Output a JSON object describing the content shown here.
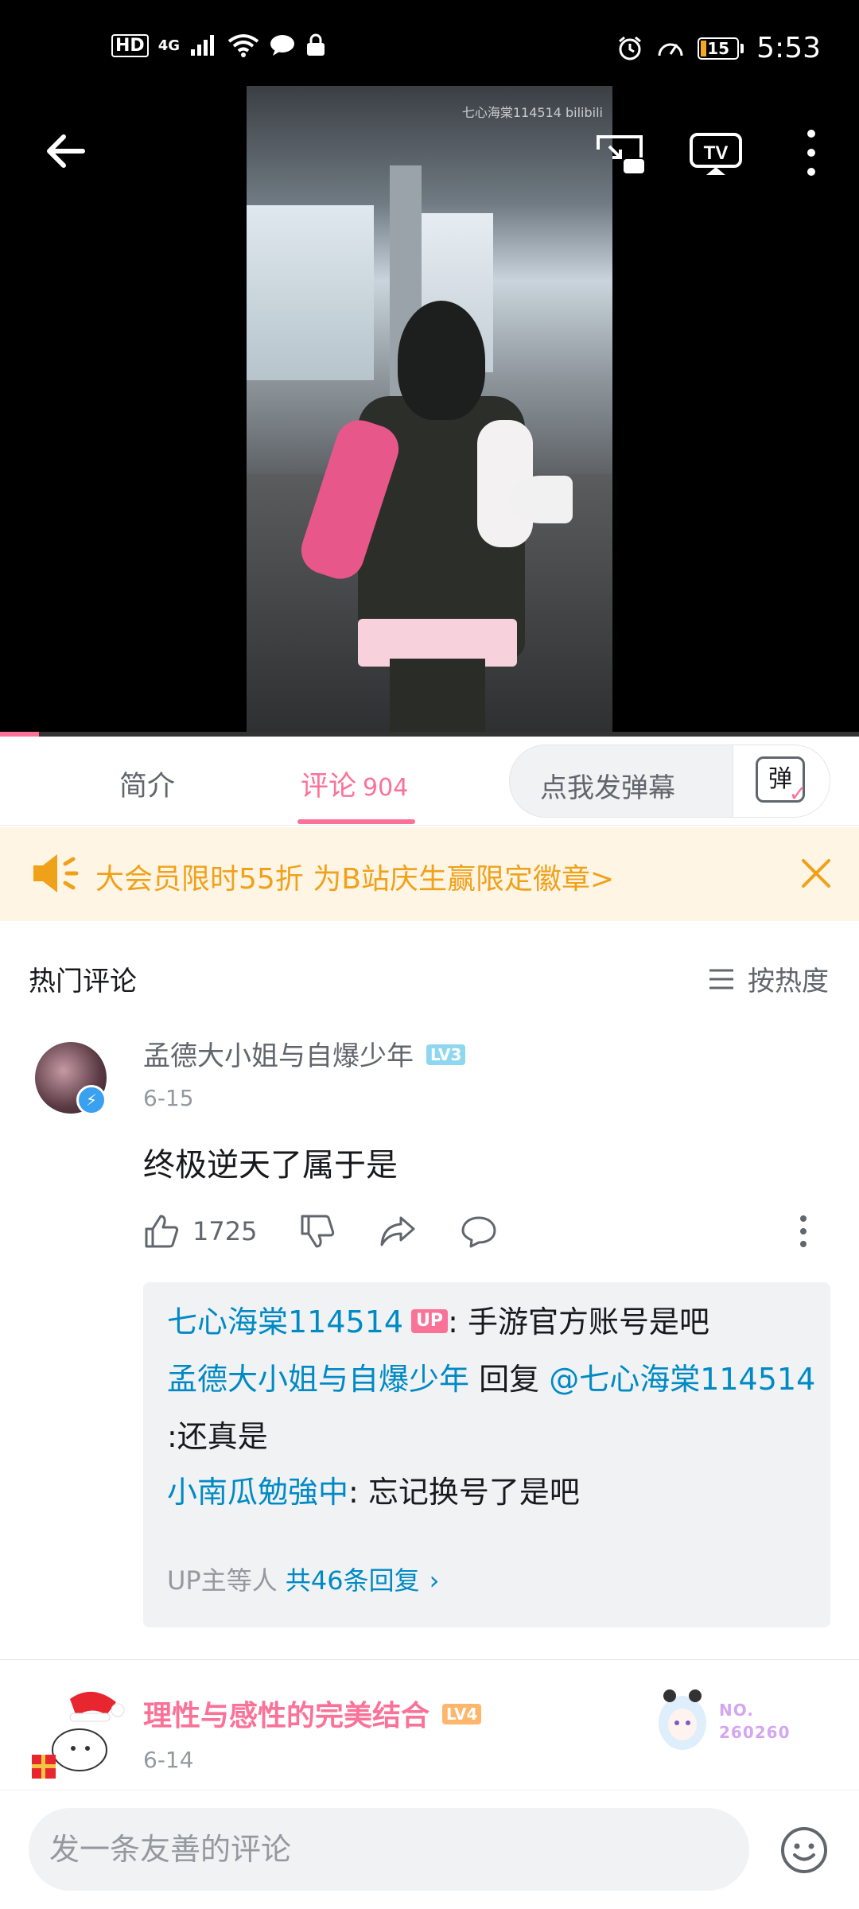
{
  "status_bar": {
    "hd": "HD",
    "network": "4G",
    "battery": "15",
    "battery_level": 0.15,
    "time": "5:53"
  },
  "video": {
    "watermark": "七心海棠114514 bilibili",
    "progress": 0.045
  },
  "tabs": {
    "intro": "简介",
    "comments": "评论",
    "comments_count": "904",
    "danmaku_placeholder": "点我发弹幕",
    "danmaku_icon_label": "弹"
  },
  "promo": {
    "text": "大会员限时55折 为B站庆生赢限定徽章>"
  },
  "comments_section": {
    "title": "热门评论",
    "sort_label": "按热度"
  },
  "comment1": {
    "username": "孟德大小姐与自爆少年",
    "level": "LV3",
    "date": "6-15",
    "text": "终极逆天了属于是",
    "likes": "1725",
    "replies": {
      "r1_name": "七心海棠114514",
      "r1_tag": "UP",
      "r1_text": ": 手游官方账号是吧",
      "r2_name": "孟德大小姐与自爆少年",
      "r2_mid": " 回复 ",
      "r2_mention": "@七心海棠114514",
      "r2_text": " :还真是",
      "r3_name": "小南瓜勉強中",
      "r3_text": ": 忘记换号了是吧",
      "more_prefix": "UP主等人 ",
      "more_link": "共46条回复"
    }
  },
  "comment2": {
    "username": "理性与感性的完美结合",
    "level": "LV4",
    "date": "6-14",
    "fan_no_label": "NO.",
    "fan_no": "260260"
  },
  "bottom_bar": {
    "placeholder": "发一条友善的评论"
  },
  "colors": {
    "brand_pink": "#fb7299",
    "link_blue": "#008ac5",
    "promo_orange": "#f0a11a"
  }
}
